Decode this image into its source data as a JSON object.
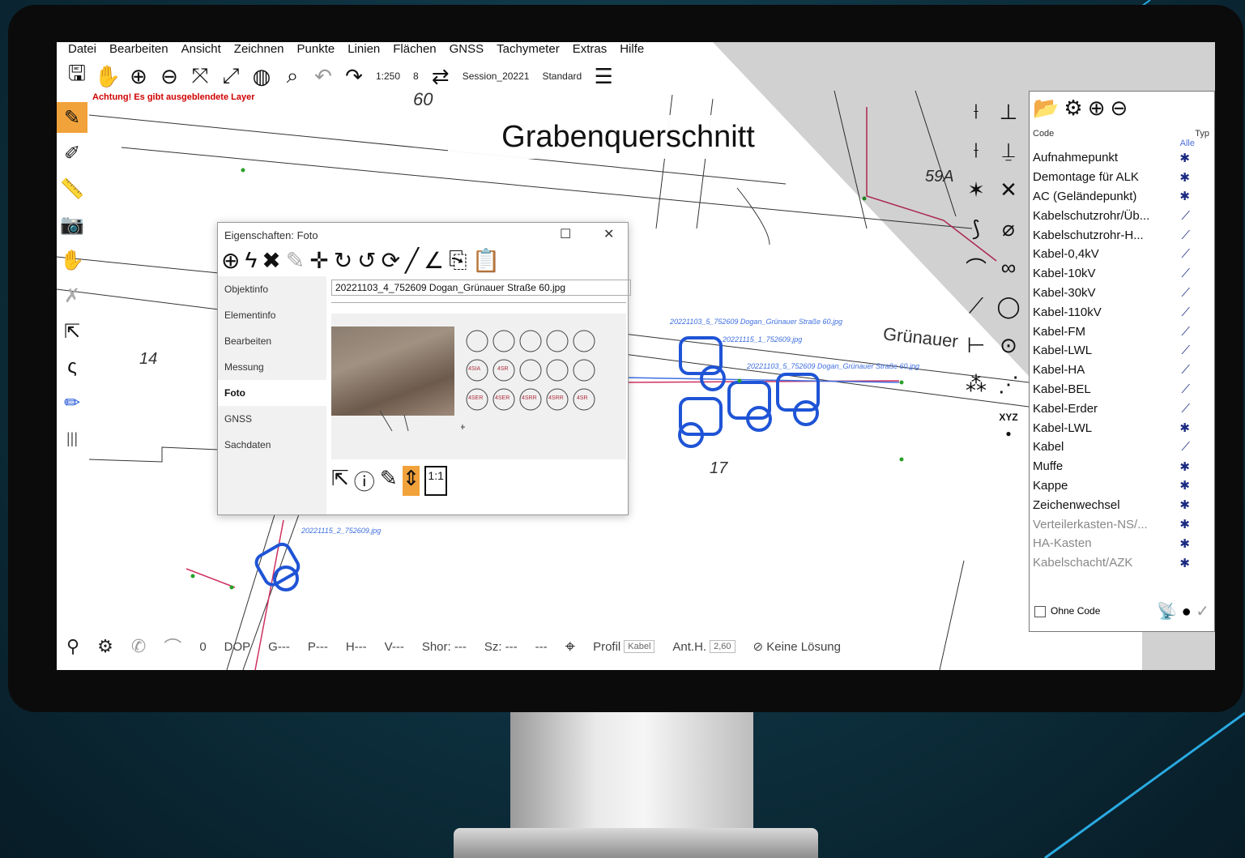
{
  "menu": [
    "Datei",
    "Bearbeiten",
    "Ansicht",
    "Zeichnen",
    "Punkte",
    "Linien",
    "Flächen",
    "GNSS",
    "Tachymeter",
    "Extras",
    "Hilfe"
  ],
  "toolbar": {
    "scale": "1:250",
    "number": "8",
    "session": "Session_20221",
    "profile": "Standard",
    "icons": [
      "save-icon",
      "hand-icon",
      "zoom-in-icon",
      "zoom-out-icon",
      "zoom-extent-icon",
      "zoom-full-icon",
      "globe-icon",
      "zoom-search-icon",
      "undo-icon",
      "redo-icon",
      "sync-icon",
      "menu-icon"
    ]
  },
  "warning": "Achtung! Es gibt ausgeblendete Layer",
  "overlay_title": "Grabenquerschnitt",
  "map_labels": {
    "n60": "60",
    "n59a": "59A",
    "street": "Grünauer",
    "n14": "14",
    "n17": "17",
    "photo1": "20221103_5_752609 Dogan_Grünauer Straße 60.jpg",
    "photo2": "20221115_1_752609.jpg",
    "photo3": "20221103_5_752609 Dogan_Grünauer Straße 60.jpg",
    "photo4": "20221115_2_752609.jpg"
  },
  "dialog": {
    "title": "Eigenschaften: Foto",
    "nav": [
      "Objektinfo",
      "Elementinfo",
      "Bearbeiten",
      "Messung",
      "Foto",
      "GNSS",
      "Sachdaten"
    ],
    "selected_nav": "Foto",
    "filename": "20221103_4_752609 Dogan_Grünauer Straße 60.jpg",
    "circle_labels": [
      "4SIA",
      "4SR",
      "4SER",
      "4SER",
      "4SRR",
      "4SRR",
      "4SR"
    ]
  },
  "code_panel": {
    "col_code": "Code",
    "col_typ": "Typ",
    "filter": "Alle",
    "rows": [
      {
        "label": "Aufnahmepunkt",
        "type": "point"
      },
      {
        "label": "Demontage für ALK",
        "type": "point"
      },
      {
        "label": "AC (Geländepunkt)",
        "type": "point"
      },
      {
        "label": "Kabelschutzrohr/Üb...",
        "type": "line"
      },
      {
        "label": "Kabelschutzrohr-H...",
        "type": "line"
      },
      {
        "label": "Kabel-0,4kV",
        "type": "line"
      },
      {
        "label": "Kabel-10kV",
        "type": "line"
      },
      {
        "label": "Kabel-30kV",
        "type": "line"
      },
      {
        "label": "Kabel-110kV",
        "type": "line"
      },
      {
        "label": "Kabel-FM",
        "type": "line"
      },
      {
        "label": "Kabel-LWL",
        "type": "line"
      },
      {
        "label": "Kabel-HA",
        "type": "line"
      },
      {
        "label": "Kabel-BEL",
        "type": "line"
      },
      {
        "label": "Kabel-Erder",
        "type": "line"
      },
      {
        "label": "Kabel-LWL",
        "type": "point"
      },
      {
        "label": "Kabel",
        "type": "line"
      },
      {
        "label": "Muffe",
        "type": "point"
      },
      {
        "label": "Kappe",
        "type": "point"
      },
      {
        "label": "Zeichenwechsel",
        "type": "point"
      },
      {
        "label": "Verteilerkasten-NS/...",
        "type": "point",
        "gray": true
      },
      {
        "label": "HA-Kasten",
        "type": "point",
        "gray": true
      },
      {
        "label": "Kabelschacht/AZK",
        "type": "point",
        "gray": true
      }
    ],
    "ohne_code": "Ohne Code"
  },
  "xyz_label": "XYZ",
  "status": {
    "zero": "0",
    "dop": "DOP",
    "g": "G---",
    "p": "P---",
    "h": "H---",
    "v": "V---",
    "shor": "Shor: ---",
    "sz": "Sz: ---",
    "dash": "---",
    "profil_label": "Profil",
    "profil_value": "Kabel",
    "anth_label": "Ant.H.",
    "anth_value": "2,60",
    "solution": "Keine Lösung"
  }
}
